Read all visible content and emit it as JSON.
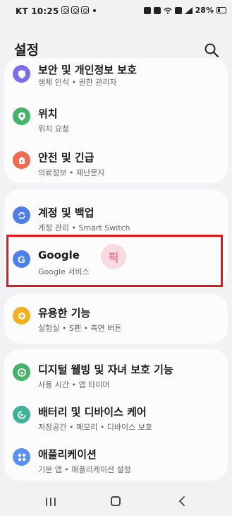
{
  "status": {
    "time": "KT 10:25",
    "battery": "28%"
  },
  "header": {
    "title": "설정"
  },
  "items": [
    {
      "label": "보안 및 개인정보 보호",
      "sub": "생체 인식 • 권한 관리자",
      "icon": "shield-icon",
      "color": "#7c6ee6"
    },
    {
      "label": "위치",
      "sub": "위치 요청",
      "icon": "location-pin-icon",
      "color": "#45b26b"
    },
    {
      "label": "안전 및 긴급",
      "sub": "의료정보 • 재난문자",
      "icon": "emergency-icon",
      "color": "#f06a54"
    },
    {
      "label": "계정 및 백업",
      "sub": "계정 관리 • Smart Switch",
      "icon": "sync-icon",
      "color": "#4f7ee8"
    },
    {
      "label": "Google",
      "sub": "Google 서비스",
      "icon": "google-icon",
      "color": "#4a82ea"
    },
    {
      "label": "유용한 기능",
      "sub": "실험실 • S펜 • 측면 버튼",
      "icon": "gear-plus-icon",
      "color": "#f3b020"
    },
    {
      "label": "디지털 웰빙 및 자녀 보호 기능",
      "sub": "사용 시간 • 앱 타이머",
      "icon": "wellbeing-icon",
      "color": "#46b26a"
    },
    {
      "label": "배터리 및 디바이스 케어",
      "sub": "저장공간 • 메모리 • 디바이스 보호",
      "icon": "device-care-icon",
      "color": "#3fb39a"
    },
    {
      "label": "애플리케이션",
      "sub": "기본 앱 • 애플리케이션 설정",
      "icon": "apps-icon",
      "color": "#5b8ff0"
    }
  ],
  "watermark": "픽"
}
